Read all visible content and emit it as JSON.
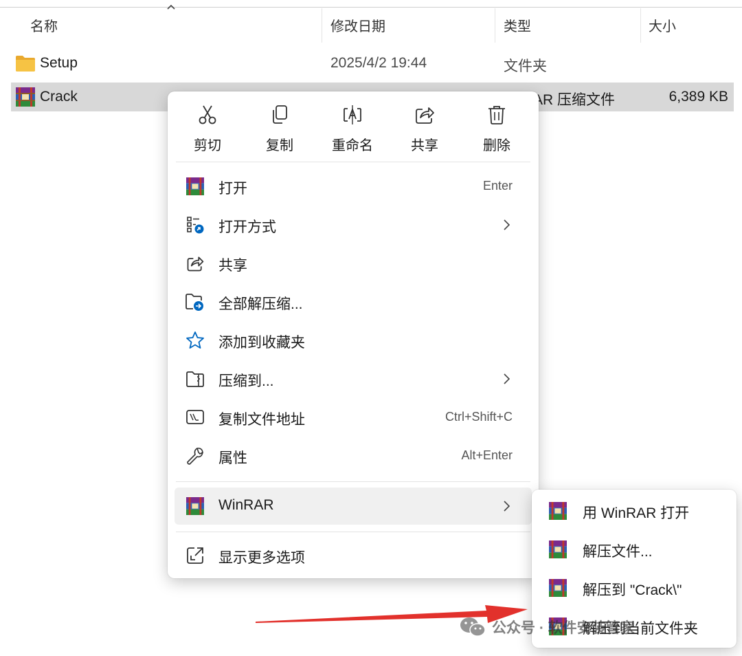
{
  "columns": {
    "name": "名称",
    "modified": "修改日期",
    "type": "类型",
    "size": "大小"
  },
  "files": [
    {
      "name": "Setup",
      "modified": "2025/4/2 19:44",
      "type": "文件夹",
      "size": "",
      "icon": "folder-icon"
    },
    {
      "name": "Crack",
      "modified": "",
      "type": "AR 压缩文件",
      "size": "6,389 KB",
      "icon": "winrar-icon",
      "selected": true
    }
  ],
  "context_menu": {
    "quick_actions": [
      {
        "label": "剪切",
        "icon": "scissors-icon"
      },
      {
        "label": "复制",
        "icon": "copy-icon"
      },
      {
        "label": "重命名",
        "icon": "rename-icon"
      },
      {
        "label": "共享",
        "icon": "share-icon"
      },
      {
        "label": "删除",
        "icon": "trash-icon"
      }
    ],
    "items": [
      {
        "label": "打开",
        "shortcut": "Enter",
        "icon": "winrar-icon"
      },
      {
        "label": "打开方式",
        "shortcut": "",
        "icon": "open-with-icon",
        "submenu": true
      },
      {
        "label": "共享",
        "shortcut": "",
        "icon": "share-icon"
      },
      {
        "label": "全部解压缩...",
        "shortcut": "",
        "icon": "extract-all-icon"
      },
      {
        "label": "添加到收藏夹",
        "shortcut": "",
        "icon": "star-icon"
      },
      {
        "label": "压缩到...",
        "shortcut": "",
        "icon": "zip-folder-icon",
        "submenu": true
      },
      {
        "label": "复制文件地址",
        "shortcut": "Ctrl+Shift+C",
        "icon": "copy-path-icon"
      },
      {
        "label": "属性",
        "shortcut": "Alt+Enter",
        "icon": "wrench-icon"
      },
      {
        "label": "WinRAR",
        "shortcut": "",
        "icon": "winrar-icon",
        "submenu": true,
        "highlighted": true
      },
      {
        "label": "显示更多选项",
        "shortcut": "",
        "icon": "more-options-icon"
      }
    ]
  },
  "winrar_submenu": {
    "items": [
      {
        "label": "用 WinRAR 打开",
        "icon": "winrar-icon"
      },
      {
        "label": "解压文件...",
        "icon": "winrar-icon"
      },
      {
        "label": "解压到 \"Crack\\\"",
        "icon": "winrar-icon"
      },
      {
        "label": "解压到当前文件夹",
        "icon": "winrar-icon"
      }
    ]
  },
  "watermark": {
    "text": "公众号 · 软件安装管家",
    "icon": "wechat-icon"
  },
  "colors": {
    "selection": "#d8d8d8",
    "folder": "#f6c344",
    "accent": "#0067c0",
    "arrow": "#e2312c"
  }
}
